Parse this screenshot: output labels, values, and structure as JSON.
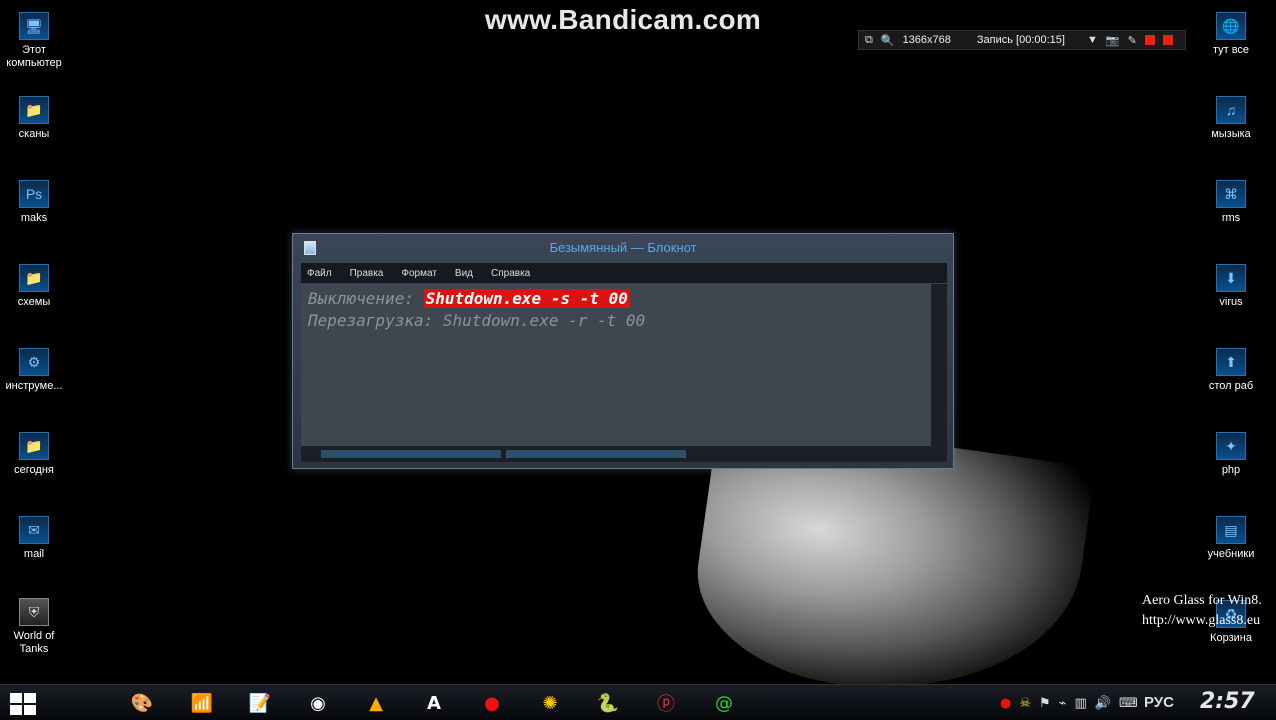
{
  "watermark": "www.Bandicam.com",
  "recorder": {
    "resolution": "1366x768",
    "status": "Запись [00:00:15]"
  },
  "desktop_left": [
    {
      "label": "Этот компьютер",
      "icon": "computer-icon"
    },
    {
      "label": "сканы",
      "icon": "folder-icon"
    },
    {
      "label": "maks",
      "icon": "photoshop-icon"
    },
    {
      "label": "схемы",
      "icon": "folder-icon"
    },
    {
      "label": "инструме...",
      "icon": "tools-icon"
    },
    {
      "label": "сегодня",
      "icon": "folder-icon"
    },
    {
      "label": "mail",
      "icon": "mail-icon"
    },
    {
      "label": "World of Tanks",
      "icon": "world-of-tanks-icon"
    }
  ],
  "desktop_right": [
    {
      "label": "тут все",
      "icon": "globe-icon"
    },
    {
      "label": "мызыка",
      "icon": "music-icon"
    },
    {
      "label": "rms",
      "icon": "network-icon"
    },
    {
      "label": "virus",
      "icon": "download-icon"
    },
    {
      "label": "стол раб",
      "icon": "upload-icon"
    },
    {
      "label": "php",
      "icon": "star-icon"
    },
    {
      "label": "учебники",
      "icon": "books-icon"
    },
    {
      "label": "Корзина",
      "icon": "recycle-bin-icon"
    }
  ],
  "notepad": {
    "title": "Безымянный — Блокнот",
    "menu": [
      "Файл",
      "Правка",
      "Формат",
      "Вид",
      "Справка"
    ],
    "line1_label": "Выключение: ",
    "line1_selected": "Shutdown.exe -s -t 00",
    "line2": "Перезагрузка: Shutdown.exe -r -t 00"
  },
  "aero_glass": {
    "line1": "Aero Glass for Win8.",
    "line2": "http://www.glass8.eu"
  },
  "taskbar": {
    "language": "РУС",
    "clock": "2:57"
  }
}
